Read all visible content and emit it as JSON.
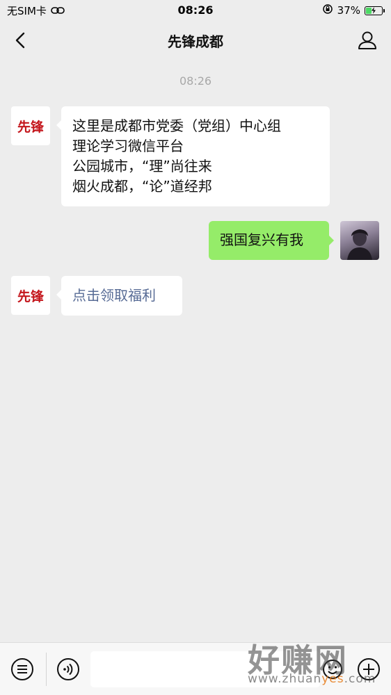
{
  "status_bar": {
    "carrier": "无SIM卡",
    "time": "08:26",
    "battery_percent": "37%",
    "battery_level": 0.37,
    "charging": true
  },
  "nav": {
    "title": "先锋成都"
  },
  "chat": {
    "timestamp": "08:26",
    "official_avatar_text": "先锋",
    "messages": [
      {
        "side": "left",
        "lines": [
          "这里是成都市党委（党组）中心组",
          "理论学习微信平台",
          "公园城市，“理”尚往来",
          "烟火成都，“论”道经邦"
        ]
      },
      {
        "side": "right",
        "text": "强国复兴有我"
      },
      {
        "side": "left",
        "text": "点击领取福利",
        "is_link": true,
        "color": "#576b95"
      }
    ]
  },
  "input_bar": {
    "value": "",
    "placeholder": ""
  },
  "watermark": {
    "brand": "好赚网",
    "url_prefix": "www.zhuan",
    "url_accent": "yes",
    "url_suffix": ".com"
  },
  "colors": {
    "background": "#ededed",
    "bubble_self": "#95ec69",
    "link": "#576b95",
    "brand_red": "#c4161c"
  }
}
